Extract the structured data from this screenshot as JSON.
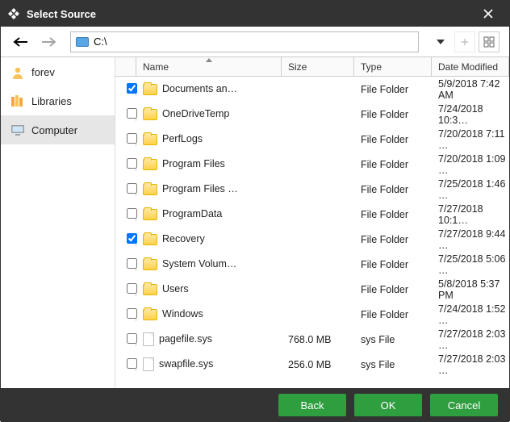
{
  "title": "Select Source",
  "path": "C:\\",
  "sidebar": {
    "items": [
      {
        "label": "forev"
      },
      {
        "label": "Libraries"
      },
      {
        "label": "Computer"
      }
    ],
    "active": 2
  },
  "columns": {
    "name": "Name",
    "size": "Size",
    "type": "Type",
    "date": "Date Modified"
  },
  "rows": [
    {
      "checked": true,
      "icon": "folder",
      "name": "Documents an…",
      "size": "",
      "type": "File Folder",
      "date": "5/9/2018 7:42 AM"
    },
    {
      "checked": false,
      "icon": "folder",
      "name": "OneDriveTemp",
      "size": "",
      "type": "File Folder",
      "date": "7/24/2018 10:3…"
    },
    {
      "checked": false,
      "icon": "folder",
      "name": "PerfLogs",
      "size": "",
      "type": "File Folder",
      "date": "7/20/2018 7:11 …"
    },
    {
      "checked": false,
      "icon": "folder",
      "name": "Program Files",
      "size": "",
      "type": "File Folder",
      "date": "7/20/2018 1:09 …"
    },
    {
      "checked": false,
      "icon": "folder",
      "name": "Program Files …",
      "size": "",
      "type": "File Folder",
      "date": "7/25/2018 1:46 …"
    },
    {
      "checked": false,
      "icon": "folder",
      "name": "ProgramData",
      "size": "",
      "type": "File Folder",
      "date": "7/27/2018 10:1…"
    },
    {
      "checked": true,
      "icon": "folder",
      "name": "Recovery",
      "size": "",
      "type": "File Folder",
      "date": "7/27/2018 9:44 …"
    },
    {
      "checked": false,
      "icon": "folder",
      "name": "System Volum…",
      "size": "",
      "type": "File Folder",
      "date": "7/25/2018 5:06 …"
    },
    {
      "checked": false,
      "icon": "folder",
      "name": "Users",
      "size": "",
      "type": "File Folder",
      "date": "5/8/2018 5:37 PM"
    },
    {
      "checked": false,
      "icon": "folder",
      "name": "Windows",
      "size": "",
      "type": "File Folder",
      "date": "7/24/2018 1:52 …"
    },
    {
      "checked": false,
      "icon": "file",
      "name": "pagefile.sys",
      "size": "768.0 MB",
      "type": "sys File",
      "date": "7/27/2018 2:03 …"
    },
    {
      "checked": false,
      "icon": "file",
      "name": "swapfile.sys",
      "size": "256.0 MB",
      "type": "sys File",
      "date": "7/27/2018 2:03 …"
    }
  ],
  "buttons": {
    "back": "Back",
    "ok": "OK",
    "cancel": "Cancel"
  }
}
